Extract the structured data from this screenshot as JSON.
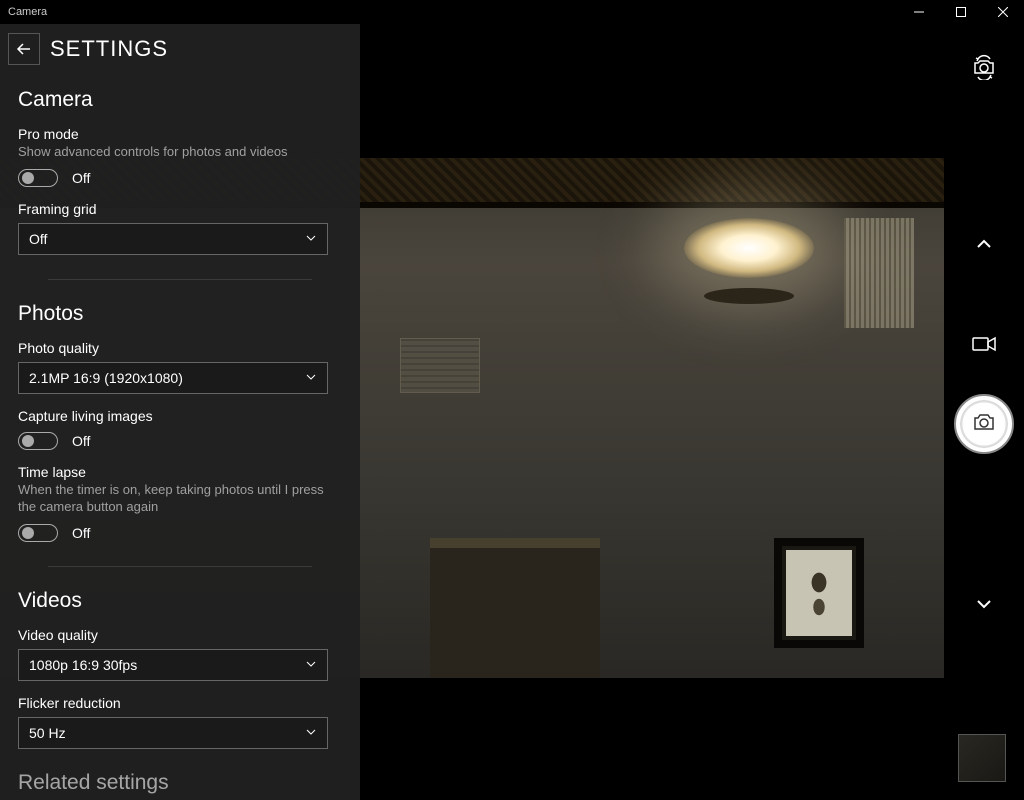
{
  "titlebar": {
    "app_name": "Camera"
  },
  "settings": {
    "title": "SETTINGS",
    "camera_section": "Camera",
    "promode": {
      "label": "Pro mode",
      "desc": "Show advanced controls for photos and videos",
      "state": "Off"
    },
    "framinggrid": {
      "label": "Framing grid",
      "value": "Off"
    },
    "photos_section": "Photos",
    "photoquality": {
      "label": "Photo quality",
      "value": "2.1MP 16:9 (1920x1080)"
    },
    "living": {
      "label": "Capture living images",
      "state": "Off"
    },
    "timelapse": {
      "label": "Time lapse",
      "desc": "When the timer is on, keep taking photos until I press the camera button again",
      "state": "Off"
    },
    "videos_section": "Videos",
    "videoquality": {
      "label": "Video quality",
      "value": "1080p 16:9 30fps"
    },
    "flicker": {
      "label": "Flicker reduction",
      "value": "50 Hz"
    },
    "related_section": "Related settings"
  }
}
